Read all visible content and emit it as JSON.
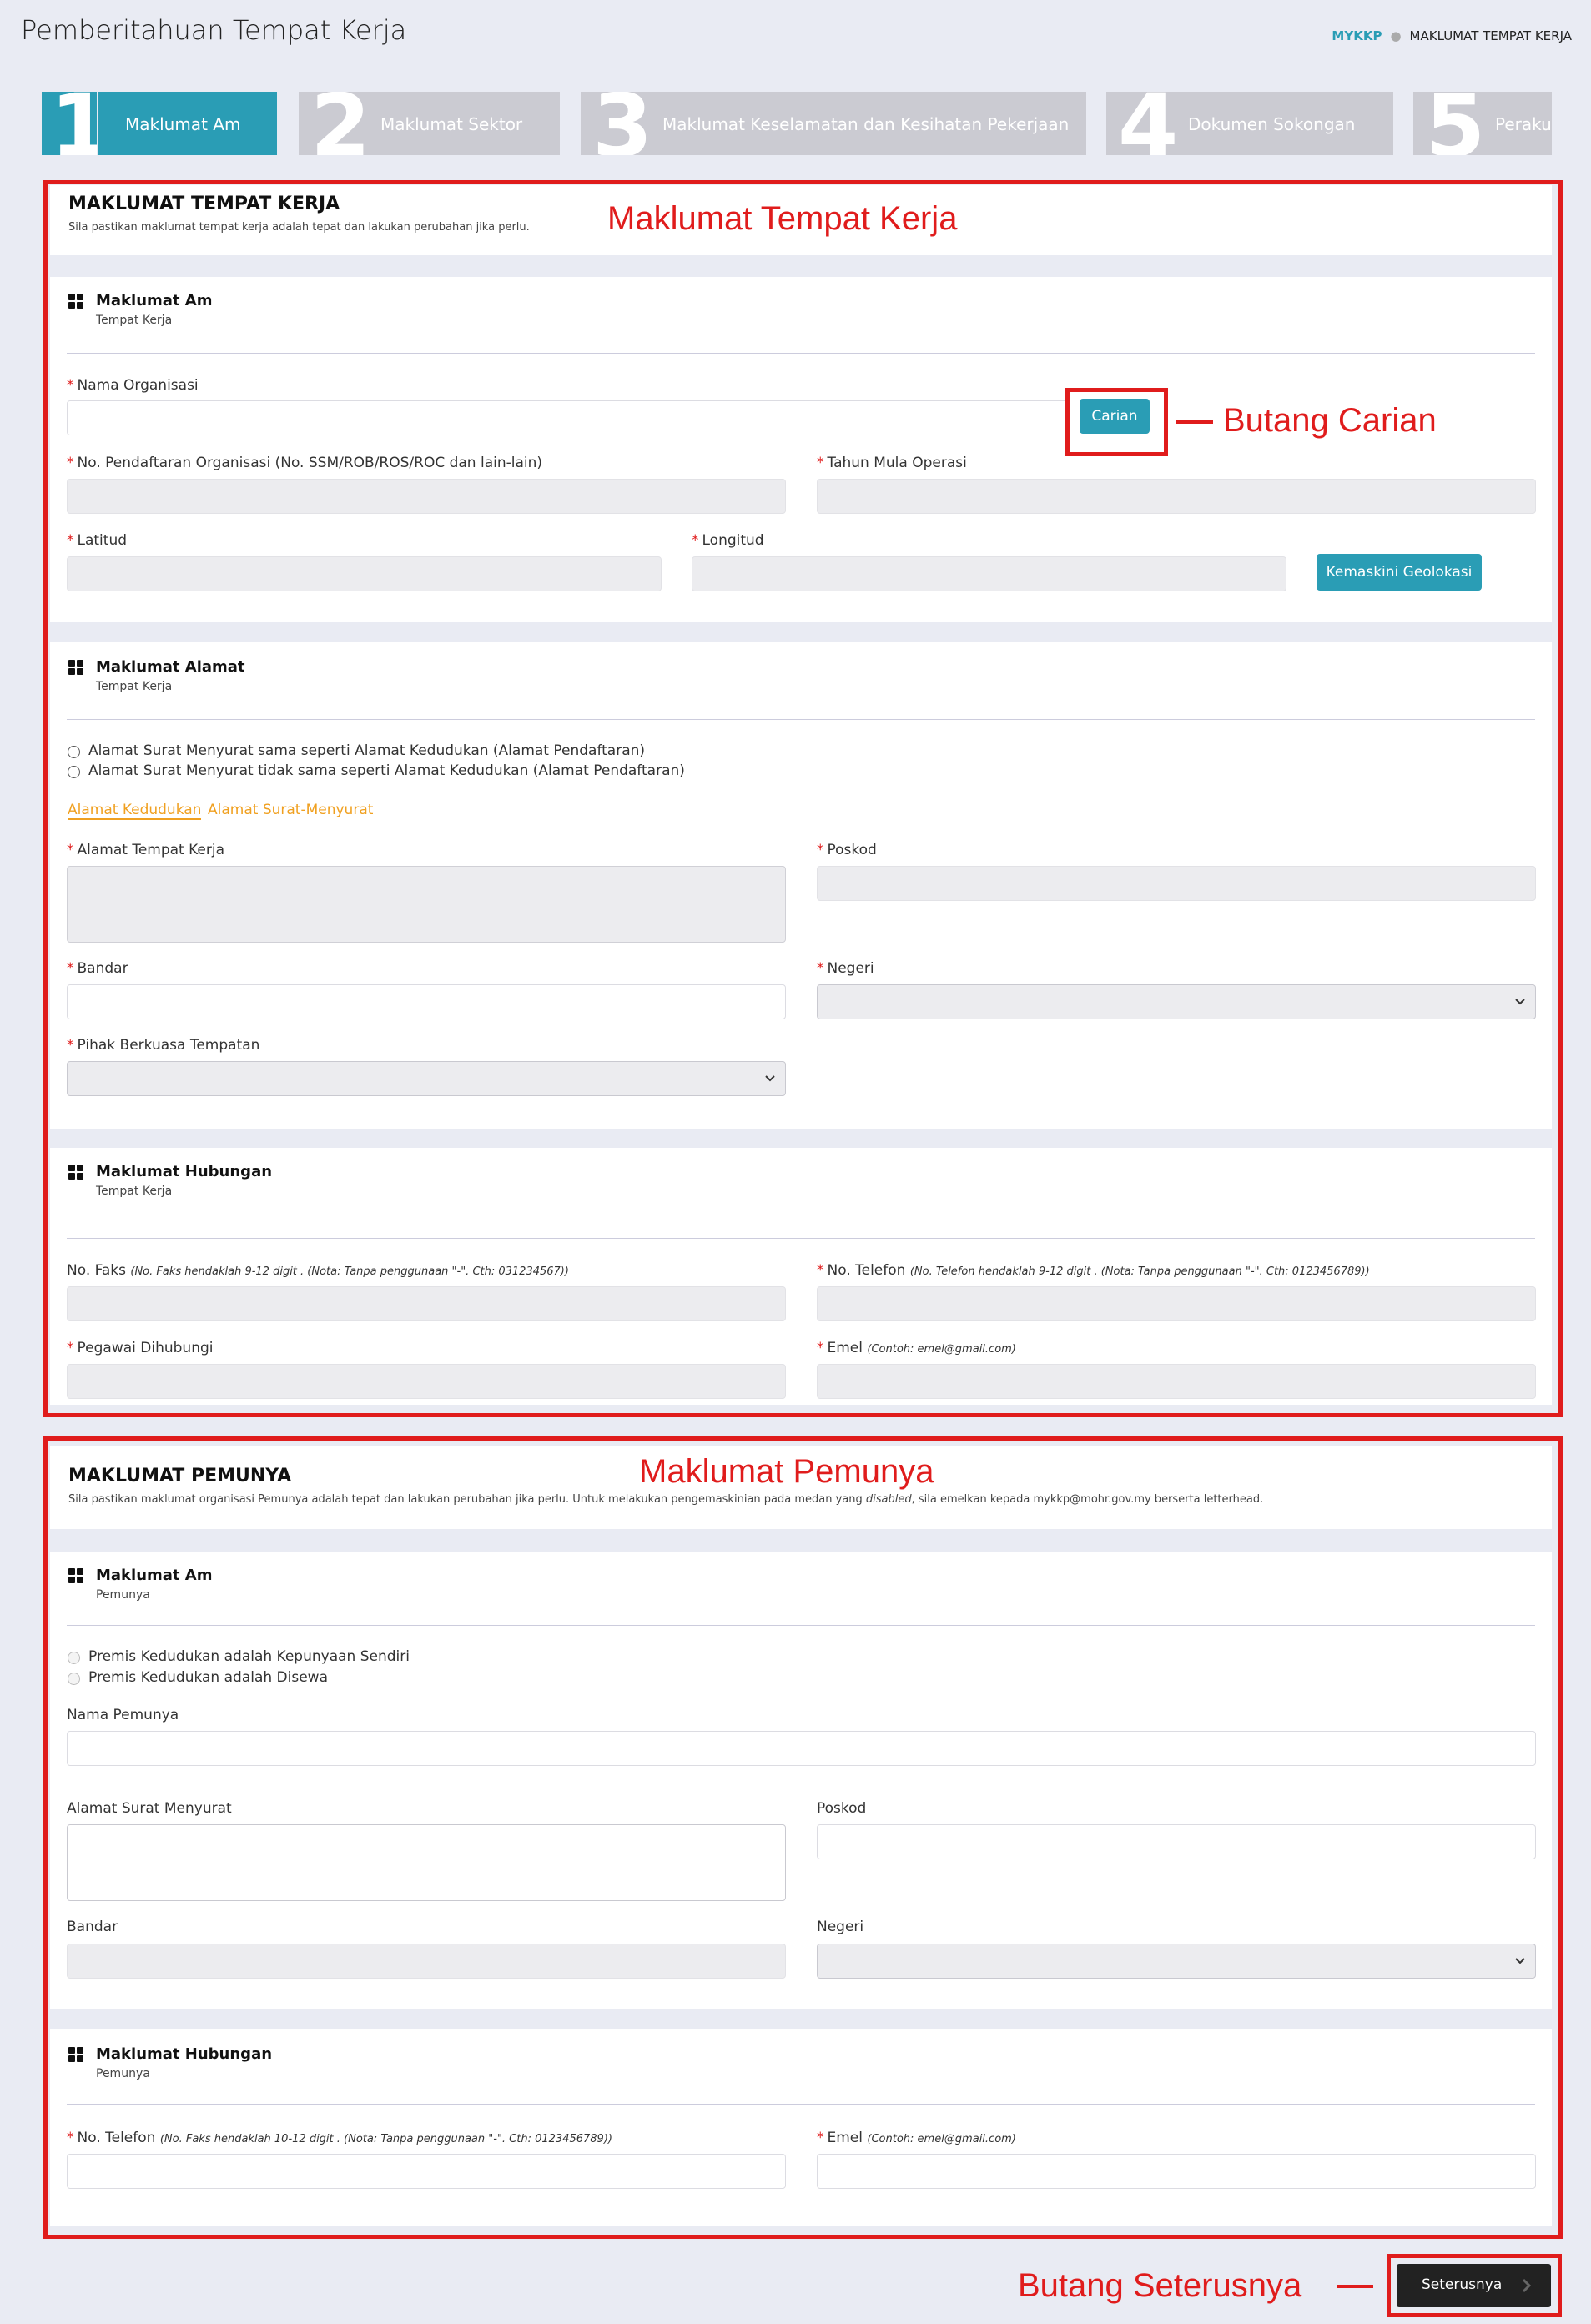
{
  "header": {
    "title": "Pemberitahuan Tempat Kerja",
    "breadcrumb_home": "MYKKP",
    "breadcrumb_current": "MAKLUMAT TEMPAT KERJA"
  },
  "steps": [
    {
      "num": "1",
      "label": "Maklumat Am"
    },
    {
      "num": "2",
      "label": "Maklumat Sektor"
    },
    {
      "num": "3",
      "label": "Maklumat Keselamatan dan Kesihatan Pekerjaan"
    },
    {
      "num": "4",
      "label": "Dokumen Sokongan"
    },
    {
      "num": "5",
      "label": "Perakuan"
    }
  ],
  "workplace": {
    "title": "MAKLUMAT TEMPAT KERJA",
    "subtitle": "Sila pastikan maklumat tempat kerja adalah tepat dan lakukan perubahan jika perlu.",
    "general": {
      "title": "Maklumat Am",
      "subtitle": "Tempat Kerja",
      "org_name_label": "Nama Organisasi",
      "search_button": "Carian",
      "reg_no_label": "No. Pendaftaran Organisasi (No. SSM/ROB/ROS/ROC dan lain-lain)",
      "start_year_label": "Tahun Mula Operasi",
      "latitude_label": "Latitud",
      "longitude_label": "Longitud",
      "geo_button": "Kemaskini Geolokasi"
    },
    "address": {
      "title": "Maklumat Alamat",
      "subtitle": "Tempat Kerja",
      "radio_same": "Alamat Surat Menyurat sama seperti Alamat Kedudukan (Alamat Pendaftaran)",
      "radio_diff": "Alamat Surat Menyurat tidak sama seperti Alamat Kedudukan (Alamat Pendaftaran)",
      "tab_location": "Alamat Kedudukan",
      "tab_mailing": "Alamat Surat-Menyurat",
      "workplace_address_label": "Alamat Tempat Kerja",
      "postcode_label": "Poskod",
      "city_label": "Bandar",
      "state_label": "Negeri",
      "local_authority_label": "Pihak Berkuasa Tempatan"
    },
    "contact": {
      "title": "Maklumat Hubungan",
      "subtitle": "Tempat Kerja",
      "fax_label": "No. Faks",
      "fax_hint": "(No. Faks hendaklah 9-12 digit . (Nota: Tanpa penggunaan \"-\". Cth: 031234567))",
      "phone_label": "No. Telefon",
      "phone_hint": "(No. Telefon hendaklah 9-12 digit . (Nota: Tanpa penggunaan \"-\". Cth: 0123456789))",
      "contact_person_label": "Pegawai Dihubungi",
      "email_label": "Emel",
      "email_hint": "(Contoh: emel@gmail.com)"
    }
  },
  "owner": {
    "title": "MAKLUMAT PEMUNYA",
    "subtitle_pre": "Sila pastikan maklumat organisasi Pemunya adalah tepat dan lakukan perubahan jika perlu. Untuk melakukan pengemaskinian pada medan yang ",
    "subtitle_em": "disabled",
    "subtitle_post": ", sila emelkan kepada mykkp@mohr.gov.my berserta letterhead.",
    "general": {
      "title": "Maklumat Am",
      "subtitle": "Pemunya",
      "radio_own": "Premis Kedudukan adalah Kepunyaan Sendiri",
      "radio_rent": "Premis Kedudukan adalah Disewa",
      "owner_name_label": "Nama Pemunya",
      "mailing_address_label": "Alamat Surat Menyurat",
      "postcode_label": "Poskod",
      "city_label": "Bandar",
      "state_label": "Negeri"
    },
    "contact": {
      "title": "Maklumat Hubungan",
      "subtitle": "Pemunya",
      "phone_label": "No. Telefon",
      "phone_hint": "(No. Faks hendaklah 10-12 digit . (Nota: Tanpa penggunaan \"-\". Cth: 0123456789))",
      "email_label": "Emel",
      "email_hint": "(Contoh: emel@gmail.com)"
    }
  },
  "footer": {
    "next_button": "Seterusnya"
  },
  "annotations": {
    "workplace_section": "Maklumat Tempat Kerja",
    "search_button": "Butang Carian",
    "owner_section": "Maklumat Pemunya",
    "next_button": "Butang Seterusnya"
  },
  "colors": {
    "accent": "#2a9db5",
    "annotation": "#e01c1c",
    "step_inactive": "#cbcbd2",
    "tab_link": "#f0a020"
  },
  "icons": [
    "grid-icon",
    "chevron-down-icon",
    "chevron-right-icon"
  ]
}
